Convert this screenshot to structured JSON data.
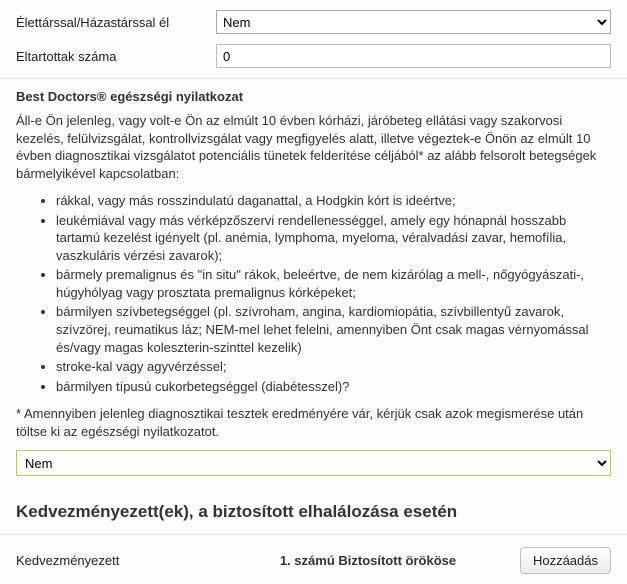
{
  "form": {
    "living_with_partner_label": "Élettárssal/Házastárssal él",
    "living_with_partner_value": "Nem",
    "dependents_label": "Eltartottak száma",
    "dependents_value": "0"
  },
  "declaration": {
    "title": "Best Doctors® egészségi nyilatkozat",
    "intro": "Áll-e Ön jelenleg, vagy volt-e Ön az elmúlt 10 évben kórházi, járóbeteg ellátási vagy szakorvosi kezelés, felülvizsgálat, kontrollvizsgálat vagy megfigyelés alatt, illetve végeztek-e Önön az elmúlt 10 évben diagnosztikai vizsgálatot potenciális tünetek felderítése céljából* az alább felsorolt betegségek bármelyikével kapcsolatban:",
    "items": [
      "rákkal, vagy más rosszindulatú daganattal, a Hodgkin kórt is ideértve;",
      "leukémiával vagy más vérképzőszervi rendellenességgel, amely egy hónapnál hosszabb tartamú kezelést igényelt (pl. anémia, lymphoma, myeloma, véralvadási zavar, hemofília, vaszkuláris vérzési zavarok);",
      "bármely premalignus és \"in situ\" rákok, beleértve, de nem kizárólag a mell-, nőgyógyászati-, húgyhólyag vagy prosztata premalignus kórképeket;",
      "bármilyen szívbetegséggel (pl. szívroham, angina, kardiomiopátia, szívbillentyű zavarok, szívzörej, reumatikus láz; NEM-mel lehet felelni, amennyiben Önt csak magas vérnyomással és/vagy magas koleszterin-szinttel kezelik)",
      "stroke-kal vagy agyvérzéssel;",
      "bármilyen típusú cukorbetegséggel (diabétesszel)?"
    ],
    "footnote": "* Amennyiben jelenleg diagnosztikai tesztek eredményére vár, kérjük csak azok megismerése után töltse ki az egészségi nyilatkozatot.",
    "answer_value": "Nem"
  },
  "beneficiary": {
    "heading": "Kedvezményezett(ek), a biztosított elhalálozása esetén",
    "label": "Kedvezményezett",
    "default_text": "1. számú Biztosított örököse",
    "add_button": "Hozzáadás"
  }
}
